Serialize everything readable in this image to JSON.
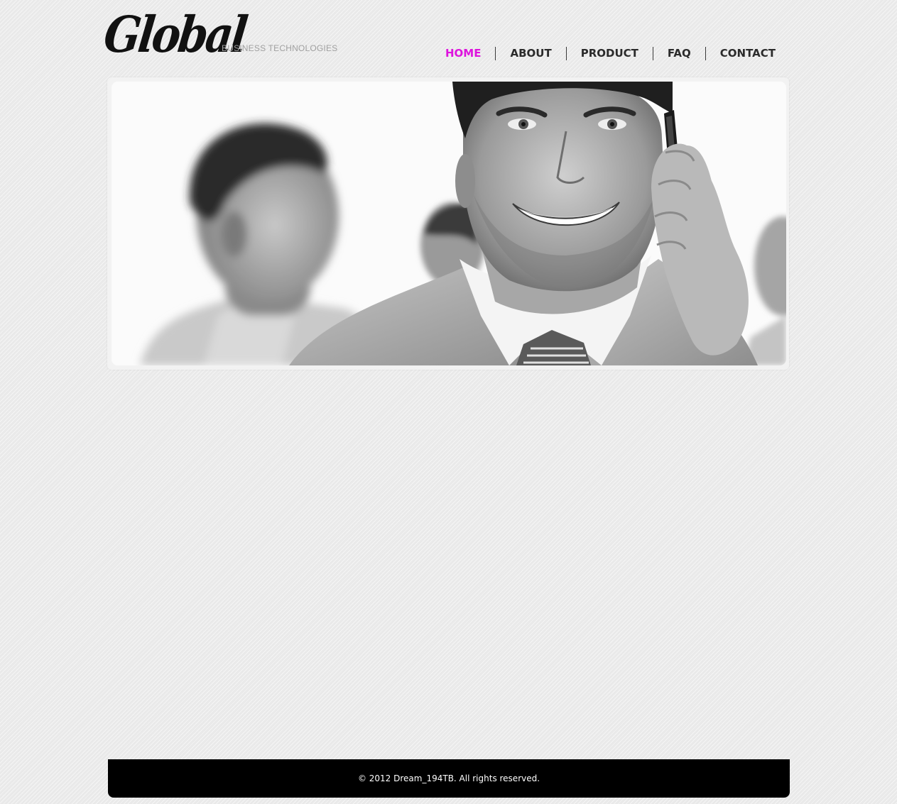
{
  "header": {
    "logo_text": "Global",
    "tagline": "BUSINESS TECHNOLOGIES"
  },
  "nav": {
    "active_color": "#dd14dd",
    "items": [
      {
        "label": "HOME",
        "active": true
      },
      {
        "label": "ABOUT",
        "active": false
      },
      {
        "label": "PRODUCT",
        "active": false
      },
      {
        "label": "FAQ",
        "active": false
      },
      {
        "label": "CONTACT",
        "active": false
      }
    ]
  },
  "footer": {
    "copyright": "© 2012 Dream_194TB. All rights reserved."
  }
}
